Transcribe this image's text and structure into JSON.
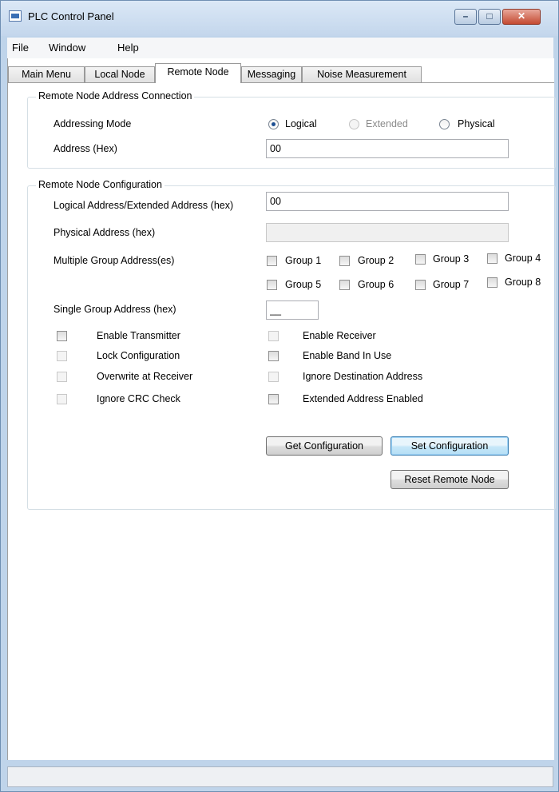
{
  "window": {
    "title": "PLC Control Panel",
    "minimize_glyph": "–",
    "maximize_glyph": "□",
    "close_glyph": "✕"
  },
  "menu": {
    "items": [
      "File",
      "Window",
      "Help"
    ]
  },
  "tabs": [
    "Main Menu",
    "Local Node",
    "Remote Node",
    "Messaging",
    "Noise Measurement"
  ],
  "active_tab": "Remote Node",
  "address_connection": {
    "title": "Remote Node Address Connection",
    "addressing_mode_label": "Addressing Mode",
    "modes": [
      {
        "label": "Logical",
        "selected": true,
        "enabled": true
      },
      {
        "label": "Extended",
        "selected": false,
        "enabled": false
      },
      {
        "label": "Physical",
        "selected": false,
        "enabled": true
      }
    ],
    "address_label": "Address (Hex)",
    "address_value": "00"
  },
  "configuration": {
    "title": "Remote Node Configuration",
    "logical_label": "Logical Address/Extended Address (hex)",
    "logical_value": "00",
    "physical_label": "Physical Address (hex)",
    "physical_value": "",
    "multiple_group_label": "Multiple Group Address(es)",
    "groups": [
      "Group 1",
      "Group 2",
      "Group 3",
      "Group 4",
      "Group 5",
      "Group 6",
      "Group 7",
      "Group 8"
    ],
    "single_group_label": "Single Group Address (hex)",
    "single_group_value": "__",
    "left_options": [
      {
        "label": "Enable Transmitter",
        "checked": false,
        "enabled": true
      },
      {
        "label": "Lock Configuration",
        "checked": false,
        "enabled": false
      },
      {
        "label": "Overwrite at Receiver",
        "checked": false,
        "enabled": false
      },
      {
        "label": "Ignore CRC Check",
        "checked": false,
        "enabled": false
      }
    ],
    "right_options": [
      {
        "label": "Enable Receiver",
        "checked": false,
        "enabled": false
      },
      {
        "label": "Enable Band In Use",
        "checked": false,
        "enabled": true
      },
      {
        "label": "Ignore Destination Address",
        "checked": false,
        "enabled": false
      },
      {
        "label": "Extended Address Enabled",
        "checked": false,
        "enabled": true
      }
    ],
    "buttons": {
      "get": "Get Configuration",
      "set": "Set Configuration",
      "reset": "Reset Remote Node"
    }
  },
  "status": {
    "text": ""
  },
  "colors": {
    "title_bar": "#c8daee",
    "close_button": "#c44a31",
    "frame_border": "#d5dfe5"
  },
  "icons": {
    "app": "plc-app-icon",
    "radio": "radio-icon",
    "checkbox": "checkbox-icon"
  }
}
